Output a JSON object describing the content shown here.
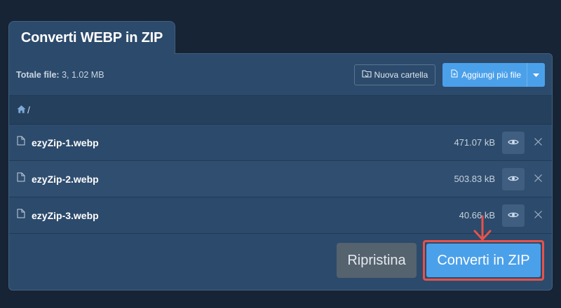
{
  "tab": {
    "title": "Converti WEBP in ZIP"
  },
  "summary": {
    "label": "Totale file:",
    "value": "3, 1.02 MB"
  },
  "toolbar": {
    "new_folder_label": "Nuova cartella",
    "add_files_label": "Aggiungi più file",
    "new_folder_icon": "folder-refresh-icon",
    "add_files_icon": "file-plus-icon"
  },
  "breadcrumb": {
    "home_icon": "home-icon",
    "path": "/"
  },
  "files": [
    {
      "name": "ezyZip-1.webp",
      "size": "471.07 kB"
    },
    {
      "name": "ezyZip-2.webp",
      "size": "503.83 kB"
    },
    {
      "name": "ezyZip-3.webp",
      "size": "40.66 kB"
    }
  ],
  "actions": {
    "reset_label": "Ripristina",
    "convert_label": "Converti in ZIP"
  },
  "colors": {
    "accent": "#4ba0ea",
    "highlight": "#e5534b",
    "panel": "#2c4a6b",
    "background": "#172435"
  }
}
